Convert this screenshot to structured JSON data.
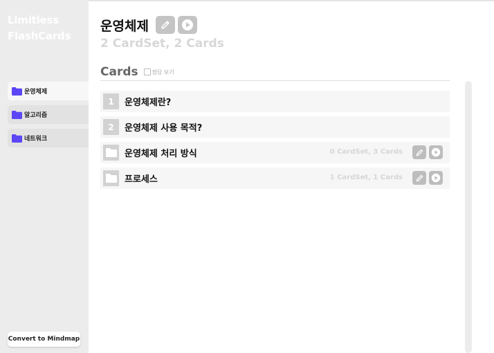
{
  "app": {
    "logo_text": "Limitless FlashCards"
  },
  "sidebar": {
    "items": [
      {
        "label": "운영체제",
        "icon": "folder-icon",
        "active": true
      },
      {
        "label": "알고리즘",
        "icon": "folder-icon",
        "active": false
      },
      {
        "label": "네트워크",
        "icon": "folder-icon",
        "active": false
      }
    ],
    "convert_button": "Convert to Mindmap"
  },
  "header": {
    "title": "운영체제",
    "subtitle": "2 CardSet, 2 Cards",
    "edit_icon": "pencil-icon",
    "play_icon": "play-icon"
  },
  "cards_section": {
    "title": "Cards",
    "show_answer_label": "정답 보기",
    "show_answer_checked": false
  },
  "rows": [
    {
      "type": "card",
      "number": "1",
      "label": "운영체제란?"
    },
    {
      "type": "card",
      "number": "2",
      "label": "운영체제 사용 목적?"
    },
    {
      "type": "set",
      "label": "운영체제 처리 방식",
      "meta": "0 CardSet, 3 Cards"
    },
    {
      "type": "set",
      "label": " 프로세스",
      "meta": "1 CardSet, 1 Cards"
    }
  ],
  "colors": {
    "folder": "#5b47f5",
    "sidebar_bg": "#ececec",
    "icon_button": "#c4c4c4"
  }
}
